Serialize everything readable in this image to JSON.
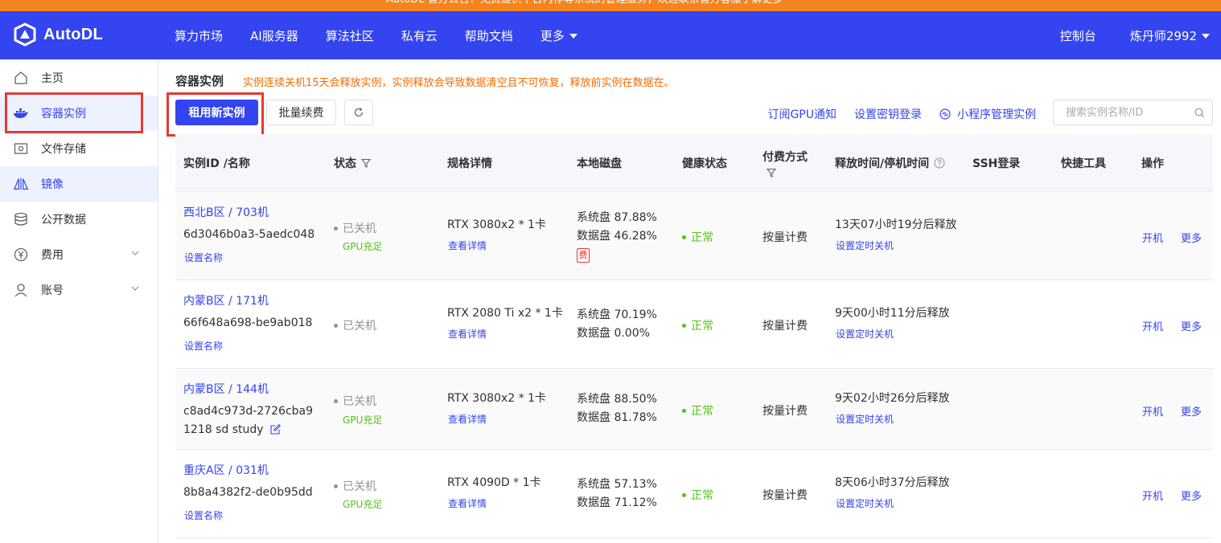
{
  "banner": {
    "text": "AutoDL 官方公告：免费提供平台内存等系统的管理服务，欢迎联系官方客服了解更多"
  },
  "app": {
    "logo_text": "AutoDL"
  },
  "topnav": {
    "items": [
      {
        "label": "算力市场"
      },
      {
        "label": "AI服务器"
      },
      {
        "label": "算法社区"
      },
      {
        "label": "私有云"
      },
      {
        "label": "帮助文档"
      },
      {
        "label": "更多"
      }
    ],
    "console": "控制台",
    "user": "炼丹师2992"
  },
  "sidebar": {
    "items": [
      {
        "label": "主页",
        "icon": "home-icon"
      },
      {
        "label": "容器实例",
        "icon": "docker-icon"
      },
      {
        "label": "文件存储",
        "icon": "storage-icon"
      },
      {
        "label": "镜像",
        "icon": "mirror-icon"
      },
      {
        "label": "公开数据",
        "icon": "database-icon"
      },
      {
        "label": "费用",
        "icon": "yen-icon"
      },
      {
        "label": "账号",
        "icon": "user-icon"
      }
    ]
  },
  "main": {
    "title": "容器实例",
    "warning": "实例连续关机15天会释放实例，实例释放会导致数据清空且不可恢复，释放前实例在数据在。",
    "toolbar": {
      "rent_new": "租用新实例",
      "batch_renew": "批量续费",
      "subscribe_gpu": "订阅GPU通知",
      "set_key_login": "设置密钥登录",
      "miniprogram": "小程序管理实例",
      "search_placeholder": "搜索实例名称/ID"
    },
    "table": {
      "headers": {
        "id_name": "实例ID /名称",
        "status": "状态",
        "spec": "规格详情",
        "disk": "本地磁盘",
        "health": "健康状态",
        "pay": "付费方式",
        "release": "释放时间/停机时间",
        "ssh": "SSH登录",
        "tools": "快捷工具",
        "ops": "操作"
      },
      "rows": [
        {
          "name": "西北B区 / 703机",
          "id": "6d3046b0a3-5aedc048",
          "id_line2": "",
          "set_name": "设置名称",
          "status": "已关机",
          "gpu_status": "GPU充足",
          "spec": "RTX 3080x2 * 1卡",
          "detail": "查看详情",
          "sys_disk": "系统盘 87.88%",
          "data_disk": "数据盘 46.28%",
          "fee_badge": "费",
          "health": "正常",
          "pay": "按量计费",
          "release": "13天07小时19分后释放",
          "timer": "设置定时关机",
          "op_start": "开机",
          "op_more": "更多"
        },
        {
          "name": "内蒙B区 / 171机",
          "id": "66f648a698-be9ab018",
          "id_line2": "",
          "set_name": "设置名称",
          "status": "已关机",
          "gpu_status": "",
          "spec": "RTX 2080 Ti x2 * 1卡",
          "detail": "查看详情",
          "sys_disk": "系统盘 70.19%",
          "data_disk": "数据盘 0.00%",
          "fee_badge": "",
          "health": "正常",
          "pay": "按量计费",
          "release": "9天00小时11分后释放",
          "timer": "设置定时关机",
          "op_start": "开机",
          "op_more": "更多"
        },
        {
          "name": "内蒙B区 / 144机",
          "id": "c8ad4c973d-2726cba9",
          "id_line2": "1218 sd study",
          "set_name": "",
          "status": "已关机",
          "gpu_status": "GPU充足",
          "spec": "RTX 3080x2 * 1卡",
          "detail": "查看详情",
          "sys_disk": "系统盘 88.50%",
          "data_disk": "数据盘 81.78%",
          "fee_badge": "",
          "health": "正常",
          "pay": "按量计费",
          "release": "9天02小时26分后释放",
          "timer": "设置定时关机",
          "op_start": "开机",
          "op_more": "更多"
        },
        {
          "name": "重庆A区 / 031机",
          "id": "8b8a4382f2-de0b95dd",
          "id_line2": "",
          "set_name": "设置名称",
          "status": "已关机",
          "gpu_status": "GPU充足",
          "spec": "RTX 4090D * 1卡",
          "detail": "查看详情",
          "sys_disk": "系统盘 57.13%",
          "data_disk": "数据盘 71.12%",
          "fee_badge": "",
          "health": "正常",
          "pay": "按量计费",
          "release": "8天06小时37分后释放",
          "timer": "设置定时关机",
          "op_start": "开机",
          "op_more": "更多"
        }
      ]
    }
  },
  "colors": {
    "brand": "#3344f0",
    "banner": "#f5841f",
    "warning": "#f56c00",
    "success": "#52c41a",
    "highlight": "#e53935"
  }
}
